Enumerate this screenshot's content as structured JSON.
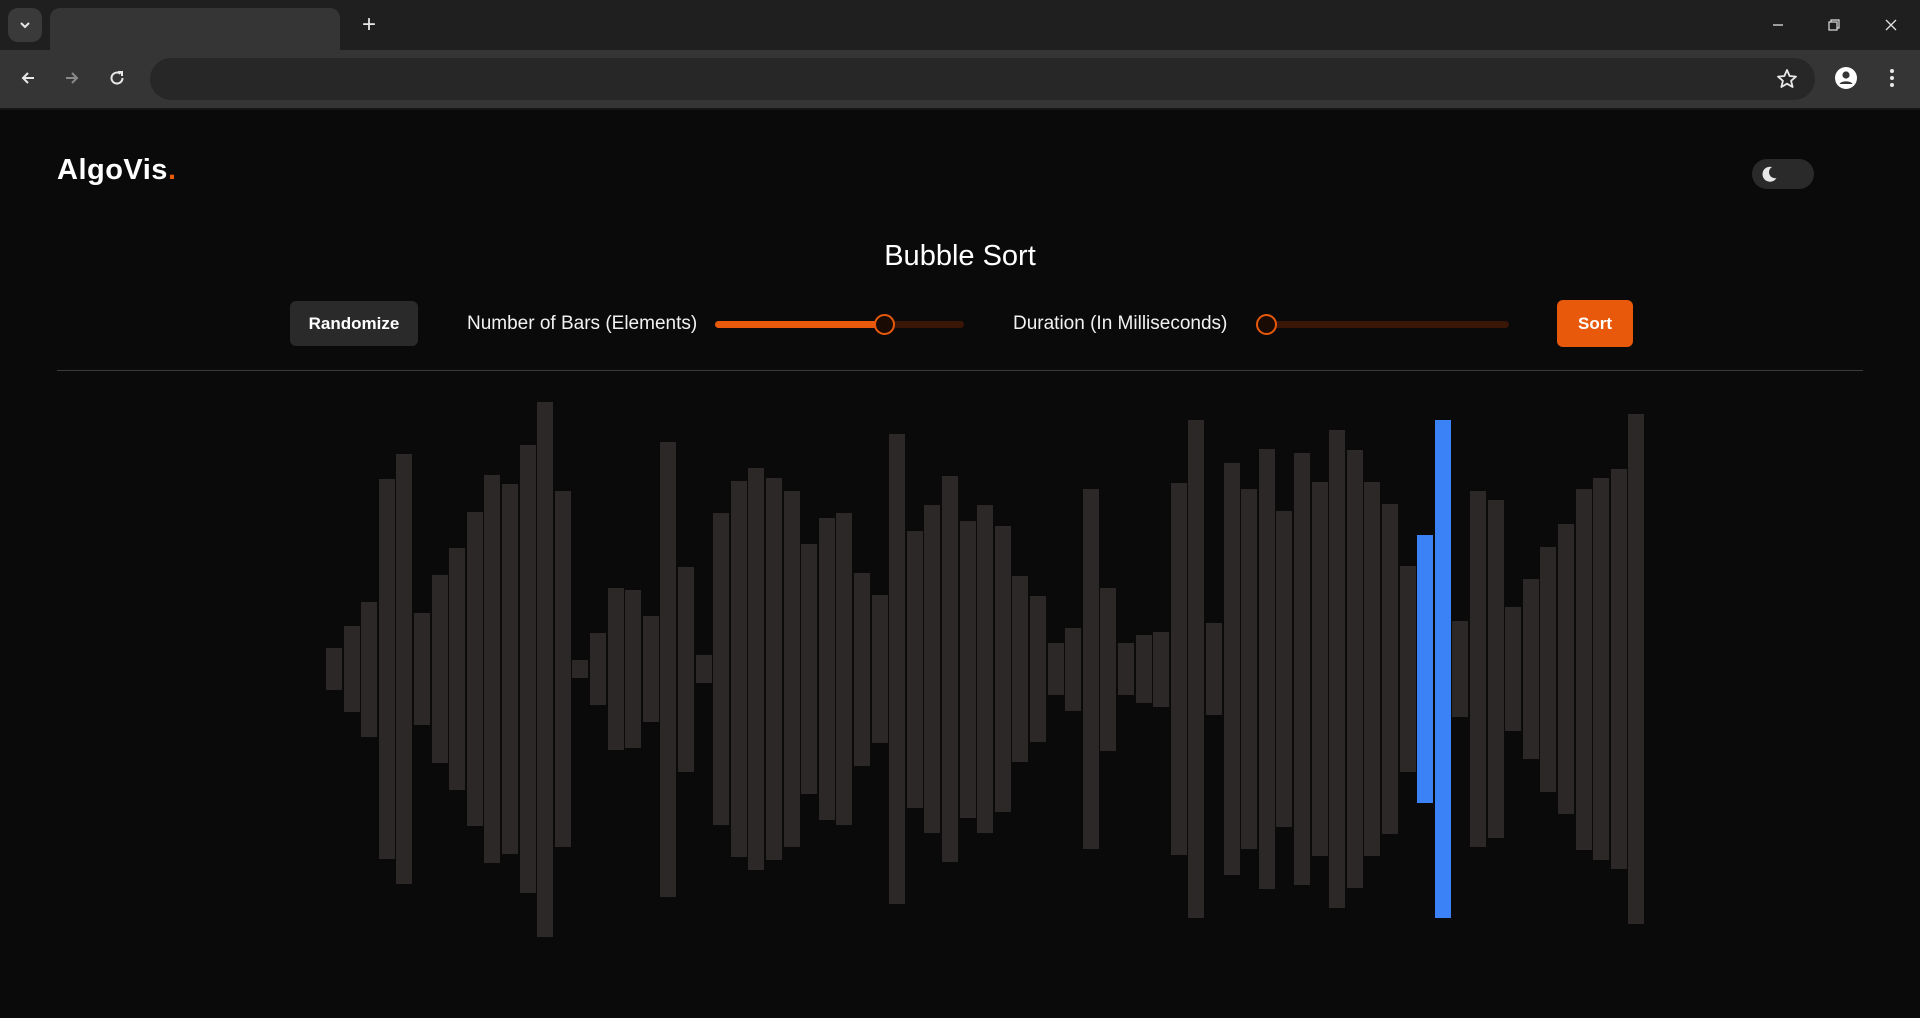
{
  "browser": {
    "new_tab_label": "+",
    "icons": {
      "tab_search": "chevron-down-icon",
      "back": "arrow-left-icon",
      "forward": "arrow-right-icon",
      "reload": "reload-icon",
      "bookmark": "star-icon",
      "profile": "account-icon",
      "menu": "kebab-icon"
    }
  },
  "app": {
    "logo_text": "AlgoVis",
    "logo_dot": ".",
    "theme_toggle_icon": "moon-icon",
    "title": "Bubble Sort"
  },
  "controls": {
    "randomize_label": "Randomize",
    "bars_label": "Number of Bars (Elements)",
    "bars_slider_value_fraction": 0.69,
    "duration_label": "Duration (In Milliseconds)",
    "duration_slider_value_fraction": 0.0,
    "sort_label": "Sort"
  },
  "colors": {
    "accent": "#e8590c",
    "bar_default": "#2b2827",
    "bar_compare": "#3b82f6",
    "background": "#0b0a0a"
  },
  "visualization": {
    "bar_values": [
      42,
      86,
      135,
      380,
      430,
      112,
      188,
      242,
      314,
      388,
      370,
      448,
      535,
      356,
      18,
      72,
      162,
      158,
      106,
      455,
      205,
      28,
      312,
      376,
      402,
      382,
      356,
      250,
      302,
      312,
      193,
      148,
      470,
      277,
      328,
      386,
      297,
      328,
      286,
      186,
      146,
      52,
      83,
      360,
      163,
      52,
      68,
      75,
      372,
      498,
      92,
      412,
      360,
      440,
      316,
      432,
      374,
      478,
      438,
      374,
      330,
      206,
      268,
      498,
      96,
      356,
      338,
      124,
      180,
      245,
      290,
      361,
      382,
      400,
      510
    ]
  }
}
